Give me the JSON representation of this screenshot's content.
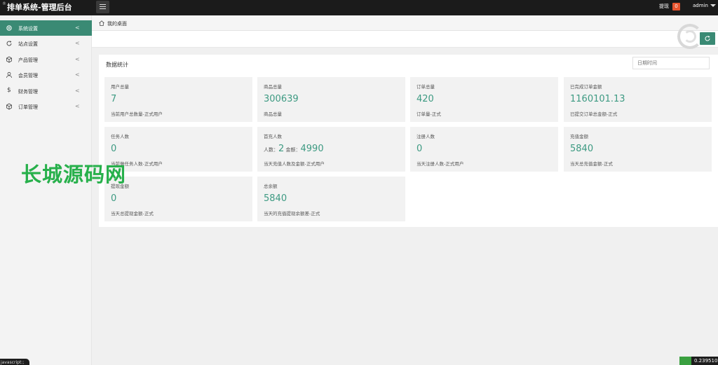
{
  "header": {
    "logo_prefix": "®",
    "title": "排单系统-管理后台",
    "withdraw_label": "提现",
    "withdraw_badge": "0",
    "user": "admin"
  },
  "sidebar": {
    "items": [
      {
        "label": "系统设置",
        "icon": "gear-icon",
        "active": true
      },
      {
        "label": "站点设置",
        "icon": "refresh-icon",
        "active": false
      },
      {
        "label": "产品管理",
        "icon": "cube-icon",
        "active": false
      },
      {
        "label": "会员管理",
        "icon": "user-icon",
        "active": false
      },
      {
        "label": "财务管理",
        "icon": "dollar-icon",
        "active": false
      },
      {
        "label": "订单管理",
        "icon": "cube-icon",
        "active": false
      }
    ]
  },
  "breadcrumb": {
    "label": "我的桌面"
  },
  "panel": {
    "title": "数据统计",
    "date_placeholder": "日期时间"
  },
  "cards": [
    {
      "title": "用户总量",
      "value": "7",
      "desc": "当前用户总数量-正式用户"
    },
    {
      "title": "商品总量",
      "value": "300639",
      "desc": "商品总量"
    },
    {
      "title": "订单总量",
      "value": "420",
      "desc": "订单量-正式"
    },
    {
      "title": "已完成订单金额",
      "value": "1160101.13",
      "desc": "已提交订单总金额-正式"
    },
    {
      "title": "任务人数",
      "value": "0",
      "desc": "当前做任务人数-正式用户"
    },
    {
      "title": "首充人数",
      "value_parts": {
        "people_label": "人数：",
        "people": "2",
        "amount_label": " 金额：",
        "amount": "4990"
      },
      "desc": "当天充值人数及金额-正式用户"
    },
    {
      "title": "注册人数",
      "value": "0",
      "desc": "当天注册人数-正式用户"
    },
    {
      "title": "充值金额",
      "value": "5840",
      "desc": "当天总充值金额-正式"
    },
    {
      "title": "提现金额",
      "value": "0",
      "desc": "当天总提现金额-正式"
    },
    {
      "title": "总余额",
      "value": "5840",
      "desc": "当天的充值提现余额差-正式"
    }
  ],
  "watermark": "长城源码网",
  "footer": {
    "js_tip": "javascript:;",
    "corner_number": "0.239510"
  },
  "colors": {
    "accent": "#3a8a74",
    "value_text": "#3d9a82",
    "badge": "#e8542e",
    "watermark": "#27b04b"
  }
}
